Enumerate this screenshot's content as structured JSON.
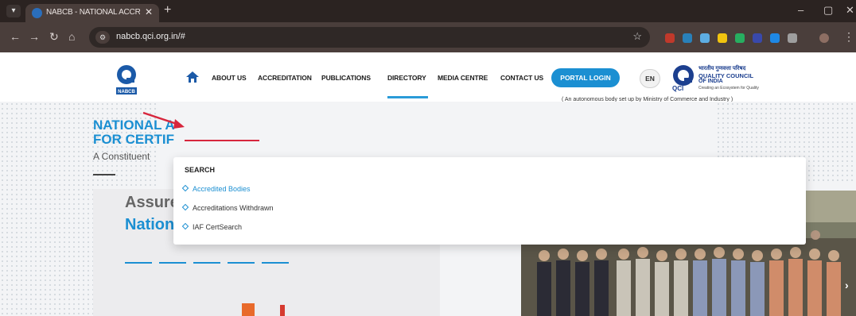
{
  "browser": {
    "tab_title": "NABCB - NATIONAL ACCREDIT",
    "tab_close": "✕",
    "new_tab": "+",
    "url": "nabcb.qci.org.in/#",
    "window_controls": [
      "–",
      "▢",
      "✕"
    ]
  },
  "header": {
    "logo_text": "NABCB",
    "nav": {
      "about": "ABOUT US",
      "accreditation": "ACCREDITATION",
      "publications": "PUBLICATIONS",
      "directory": "DIRECTORY",
      "media": "MEDIA CENTRE",
      "contact": "CONTACT US"
    },
    "portal_login": "PORTAL LOGIN",
    "language": "EN",
    "qci": {
      "hindi": "भारतीय गुणवत्ता परिषद",
      "name": "QUALITY COUNCIL",
      "sub": "OF INDIA",
      "tagline": "Creating an Ecosystem for Quality",
      "brand": "QCI"
    },
    "autonomous_text": "( An autonomous body set up by Ministry of Commerce and Industry )"
  },
  "dropdown": {
    "heading": "SEARCH",
    "items": [
      "Accredited Bodies",
      "Accreditations Withdrawn",
      "IAF CertSearch"
    ]
  },
  "hero": {
    "title_line1": "NATIONAL A",
    "title_line2": "FOR CERTIF",
    "subtitle": "A Constituent",
    "slide_line1": "Assures",
    "slide_line2": "National Recognit"
  },
  "colors": {
    "brand_blue": "#1b8fd2",
    "annotation_red": "#d7263d",
    "chrome_dark": "#2b2321"
  }
}
